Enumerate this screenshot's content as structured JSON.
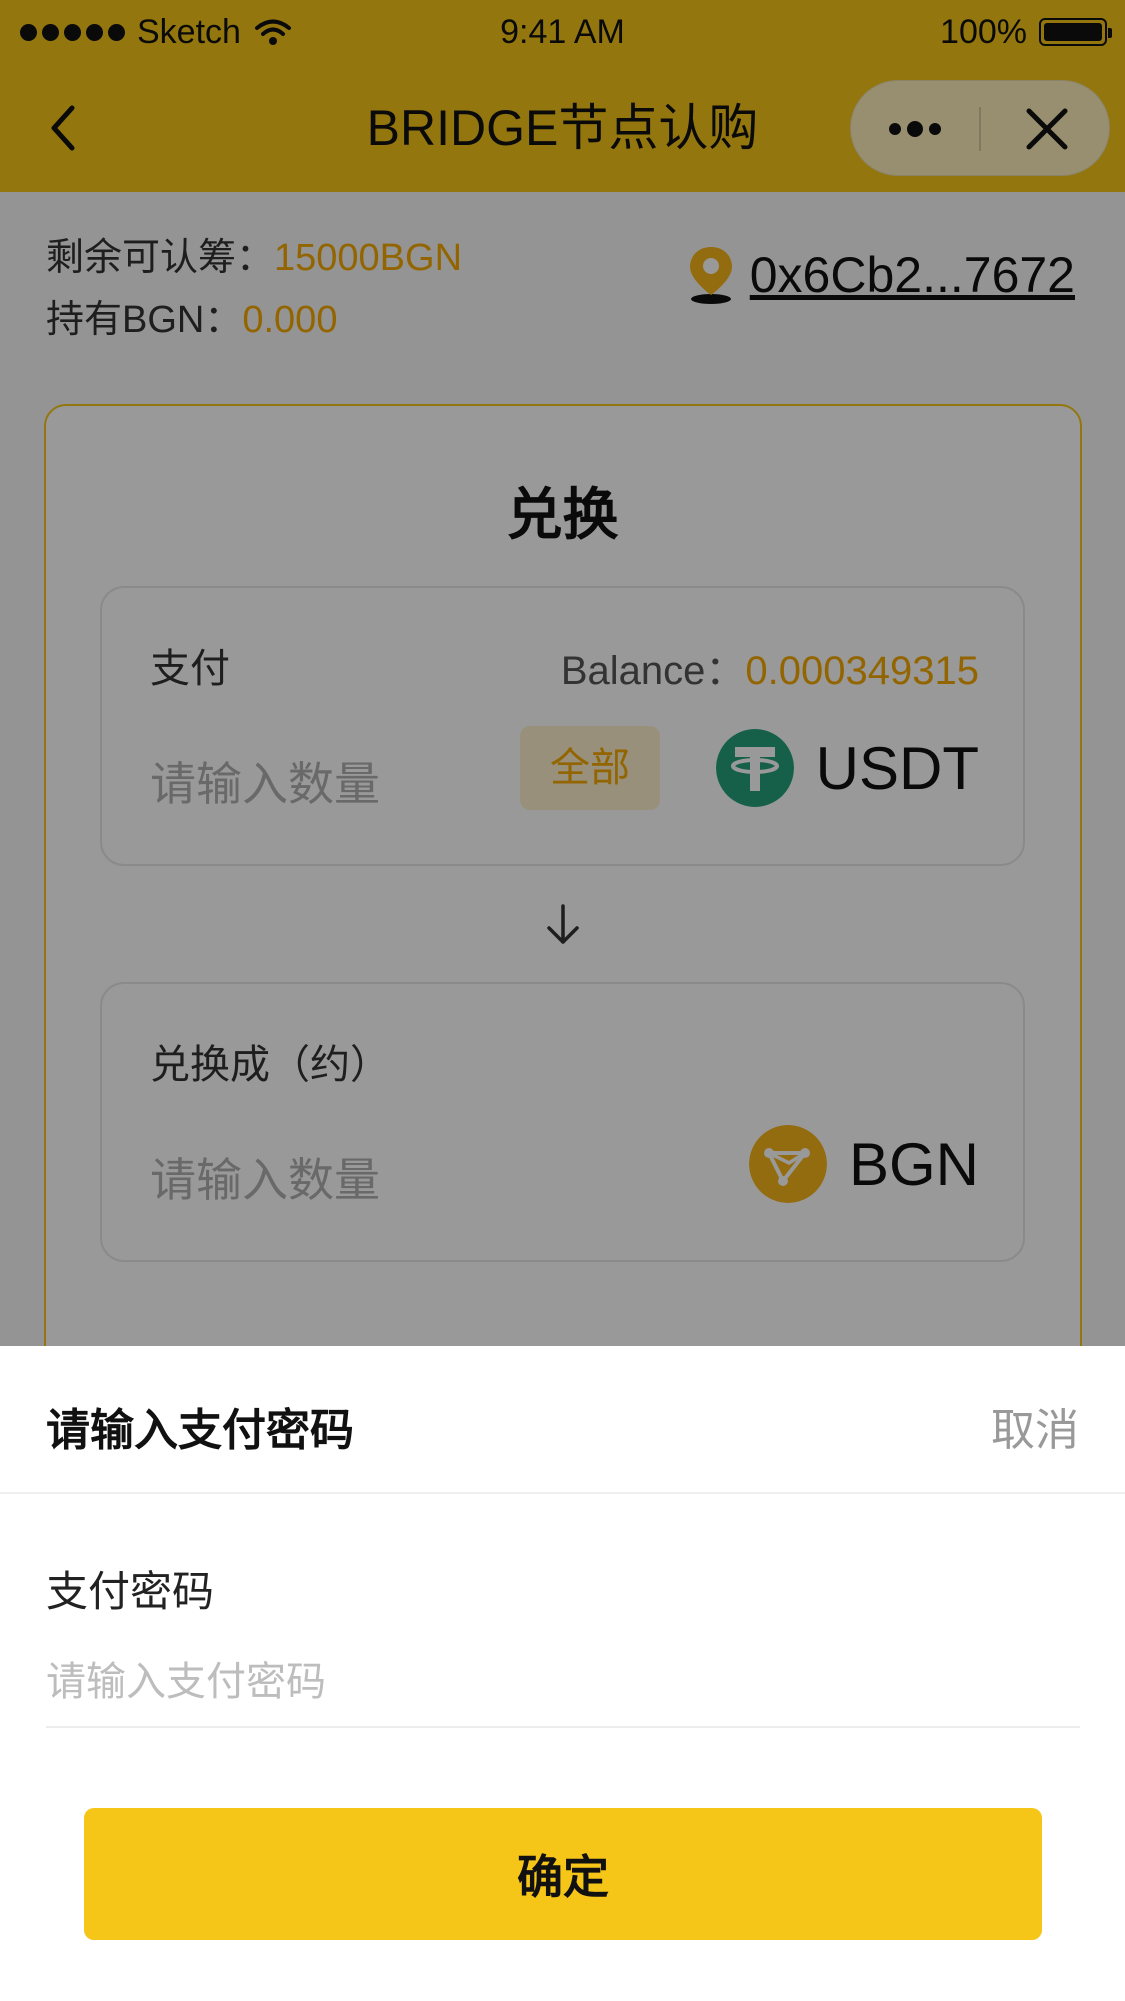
{
  "status_bar": {
    "carrier": "Sketch",
    "time": "9:41 AM",
    "battery": "100%"
  },
  "nav": {
    "title": "BRIDGE节点认购",
    "icons": [
      "back-arrow-icon",
      "more-dots-icon",
      "close-icon"
    ]
  },
  "info": {
    "remaining_label": "剩余可认筹：",
    "remaining_value": "15000BGN",
    "holding_label": "持有BGN：",
    "holding_value": "0.000",
    "address": "0x6Cb2...7672",
    "address_icon": "location-pin-icon"
  },
  "exchange": {
    "title": "兑换",
    "pay": {
      "label": "支付",
      "balance_label": "Balance：",
      "balance_value": "0.000349315",
      "placeholder": "请输入数量",
      "all_button": "全部",
      "token": "USDT",
      "token_color": "#26A17B"
    },
    "arrow_icon": "arrow-down-icon",
    "receive": {
      "label": "兑换成（约）",
      "placeholder": "请输入数量",
      "token": "BGN",
      "token_color": "#F5B41A"
    }
  },
  "sheet": {
    "title": "请输入支付密码",
    "cancel": "取消",
    "password_label": "支付密码",
    "password_placeholder": "请输入支付密码",
    "confirm": "确定"
  },
  "colors": {
    "brand_yellow": "#F5C518",
    "accent_orange": "#F5A800",
    "overlay": "rgba(0,0,0,0.4)"
  }
}
